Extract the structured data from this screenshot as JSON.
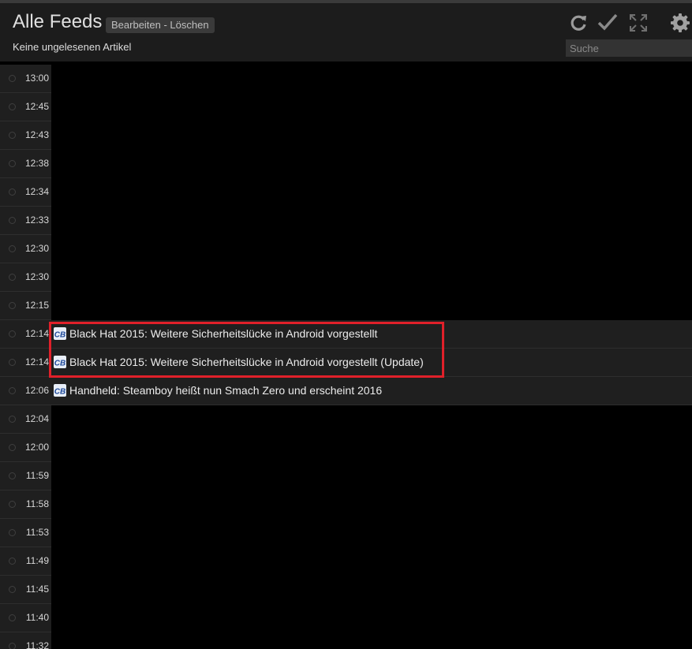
{
  "header": {
    "title": "Alle Feeds",
    "actions_label": "Bearbeiten - Löschen",
    "subtitle": "Keine ungelesenen Artikel",
    "search_placeholder": "Suche",
    "icons": [
      "refresh-icon",
      "checkmark-icon",
      "fullscreen-icon",
      "gear-icon"
    ]
  },
  "feed_icon_text": "CB",
  "colors": {
    "highlight": "#e0202a",
    "background": "#000000",
    "row": "#1f1f1f"
  },
  "rows": [
    {
      "time": "13:00"
    },
    {
      "time": "12:45"
    },
    {
      "time": "12:43"
    },
    {
      "time": "12:38"
    },
    {
      "time": "12:34"
    },
    {
      "time": "12:33"
    },
    {
      "time": "12:30"
    },
    {
      "time": "12:30"
    },
    {
      "time": "12:15"
    },
    {
      "time": "12:14",
      "title": "Black Hat 2015: Weitere Sicherheitslücke in Android vorgestellt"
    },
    {
      "time": "12:14",
      "title": "Black Hat 2015: Weitere Sicherheitslücke in Android vorgestellt (Update)"
    },
    {
      "time": "12:06",
      "title": "Handheld: Steamboy heißt nun Smach Zero und erscheint 2016"
    },
    {
      "time": "12:04"
    },
    {
      "time": "12:00"
    },
    {
      "time": "11:59"
    },
    {
      "time": "11:58"
    },
    {
      "time": "11:53"
    },
    {
      "time": "11:49"
    },
    {
      "time": "11:45"
    },
    {
      "time": "11:40"
    },
    {
      "time": "11:32"
    }
  ]
}
